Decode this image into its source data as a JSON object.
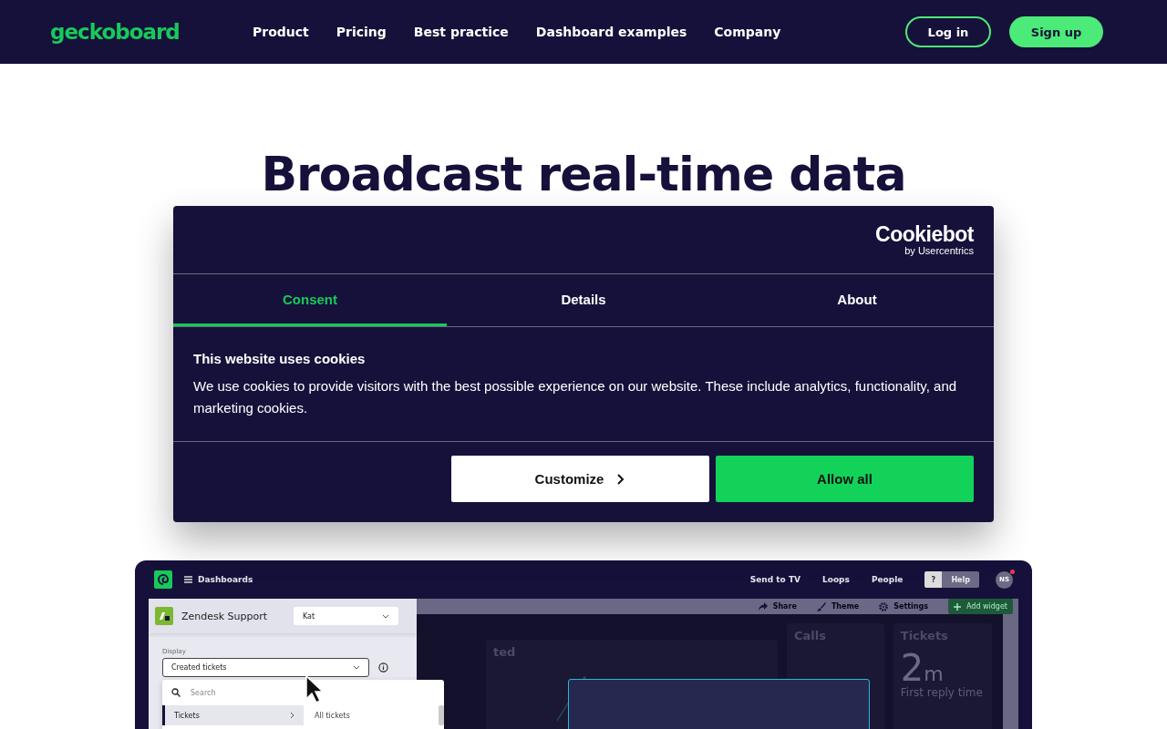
{
  "nav": {
    "logo": "geckoboard",
    "links": [
      "Product",
      "Pricing",
      "Best practice",
      "Dashboard examples",
      "Company"
    ],
    "login": "Log in",
    "signup": "Sign up"
  },
  "hero": {
    "heading": "Broadcast real-time data"
  },
  "cookie_dialog": {
    "brand": "Cookiebot",
    "brand_sub": "by Usercentrics",
    "tabs": [
      {
        "label": "Consent",
        "selected": true
      },
      {
        "label": "Details",
        "selected": false
      },
      {
        "label": "About",
        "selected": false
      }
    ],
    "heading": "This website uses cookies",
    "body": "We use cookies to provide visitors with the best possible experience on our website. These include analytics, functionality, and marketing cookies.",
    "buttons": [
      {
        "label": "Customize",
        "kind": "secondary"
      },
      {
        "label": "Allow all",
        "kind": "primary"
      }
    ]
  },
  "app_preview": {
    "menu_label": "Dashboards",
    "links": [
      "Send to TV",
      "Loops",
      "People"
    ],
    "help_key": "?",
    "help": "Help",
    "avatar": "NS",
    "notification": true,
    "toolbar": [
      {
        "label": "Share",
        "kind": "share"
      },
      {
        "label": "Theme",
        "kind": "theme"
      },
      {
        "label": "Settings",
        "kind": "settings"
      }
    ],
    "add_widget": "Add widget",
    "sidebar": {
      "source": "Zendesk Support",
      "user": "Kat",
      "field_label": "Display",
      "field_value": "Created tickets",
      "search_placeholder": "Search",
      "items": [
        {
          "label": "Tickets",
          "selected": true
        }
      ],
      "subitems": [
        "All tickets"
      ]
    },
    "widgets": [
      {
        "title": "ted",
        "kind": "chart"
      },
      {
        "title": "Calls",
        "kind": "empty"
      },
      {
        "title": "Tickets",
        "kind": "number",
        "value": "2",
        "unit": "m",
        "caption": "First reply time"
      }
    ]
  }
}
